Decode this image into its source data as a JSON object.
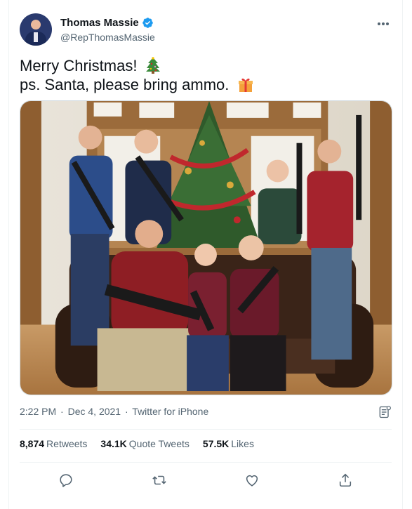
{
  "author": {
    "display_name": "Thomas Massie",
    "handle": "@RepThomasMassie",
    "verified": true
  },
  "tweet": {
    "line1": "Merry Christmas!",
    "line2": "ps. Santa, please bring ammo.",
    "line1_emoji": "christmas-tree-emoji",
    "line2_emoji": "wrapped-gift-emoji"
  },
  "meta": {
    "time": "2:22 PM",
    "date": "Dec 4, 2021",
    "source": "Twitter for iPhone",
    "separator": "·"
  },
  "stats": {
    "retweets_count": "8,874",
    "retweets_label": "Retweets",
    "quote_count": "34.1K",
    "quote_label": "Quote Tweets",
    "likes_count": "57.5K",
    "likes_label": "Likes"
  },
  "icons": {
    "more": "more-icon",
    "analytics": "analytics-icon",
    "reply": "reply-icon",
    "retweet": "retweet-icon",
    "like": "like-icon",
    "share": "share-icon"
  },
  "colors": {
    "text": "#0f1419",
    "secondary": "#536471",
    "verified": "#1d9bf0",
    "divider": "#eff3f4"
  }
}
